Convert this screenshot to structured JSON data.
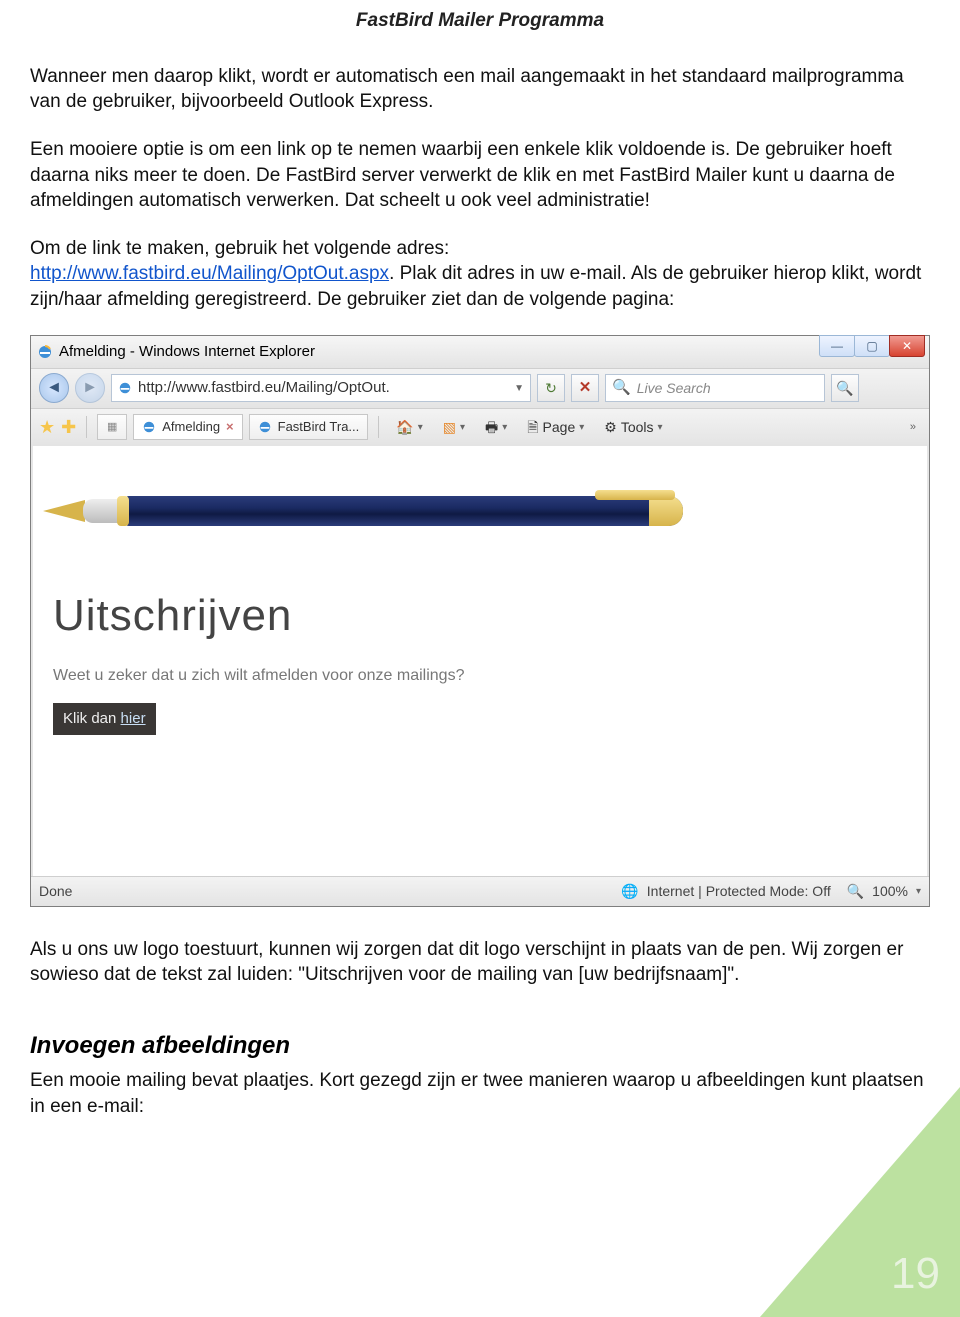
{
  "header": {
    "title": "FastBird Mailer Programma"
  },
  "body": {
    "p1": "Wanneer men daarop klikt, wordt er automatisch een mail aangemaakt in het standaard mailprogramma van de gebruiker, bijvoorbeeld Outlook Express.",
    "p2": "Een mooiere optie is om een link op te nemen waarbij een enkele klik voldoende is. De gebruiker hoeft daarna niks meer te doen. De FastBird server verwerkt de klik en met FastBird Mailer kunt u daarna de afmeldingen automatisch verwerken. Dat scheelt u ook veel administratie!",
    "p3a": "Om de link te maken, gebruik het volgende adres:",
    "p3link": "http://www.fastbird.eu/Mailing/OptOut.aspx",
    "p3b": ". Plak dit adres in uw e-mail. Als de gebruiker hierop klikt, wordt zijn/haar afmelding geregistreerd. De gebruiker ziet dan de volgende pagina:",
    "p4": "Als u ons uw logo toestuurt, kunnen wij zorgen dat dit logo verschijnt in plaats van de pen. Wij zorgen er sowieso dat de tekst zal luiden: \"Uitschrijven voor de mailing van [uw bedrijfsnaam]\".",
    "h2": "Invoegen afbeeldingen",
    "p5": "Een mooie mailing bevat plaatjes. Kort gezegd zijn er twee manieren waarop u afbeeldingen kunt plaatsen in een e-mail:"
  },
  "ie": {
    "title": "Afmelding - Windows Internet Explorer",
    "url": "http://www.fastbird.eu/Mailing/OptOut.",
    "search_placeholder": "Live Search",
    "tabs": {
      "t1": "Afmelding",
      "t2": "FastBird Tra..."
    },
    "menu": {
      "page": "Page",
      "tools": "Tools"
    },
    "content": {
      "heading": "Uitschrijven",
      "question": "Weet u zeker dat u zich wilt afmelden voor onze mailings?",
      "klik": "Klik dan ",
      "hier": "hier"
    },
    "status": {
      "done": "Done",
      "zone": "Internet | Protected Mode: Off",
      "zoom": "100%"
    }
  },
  "page_number": "19"
}
